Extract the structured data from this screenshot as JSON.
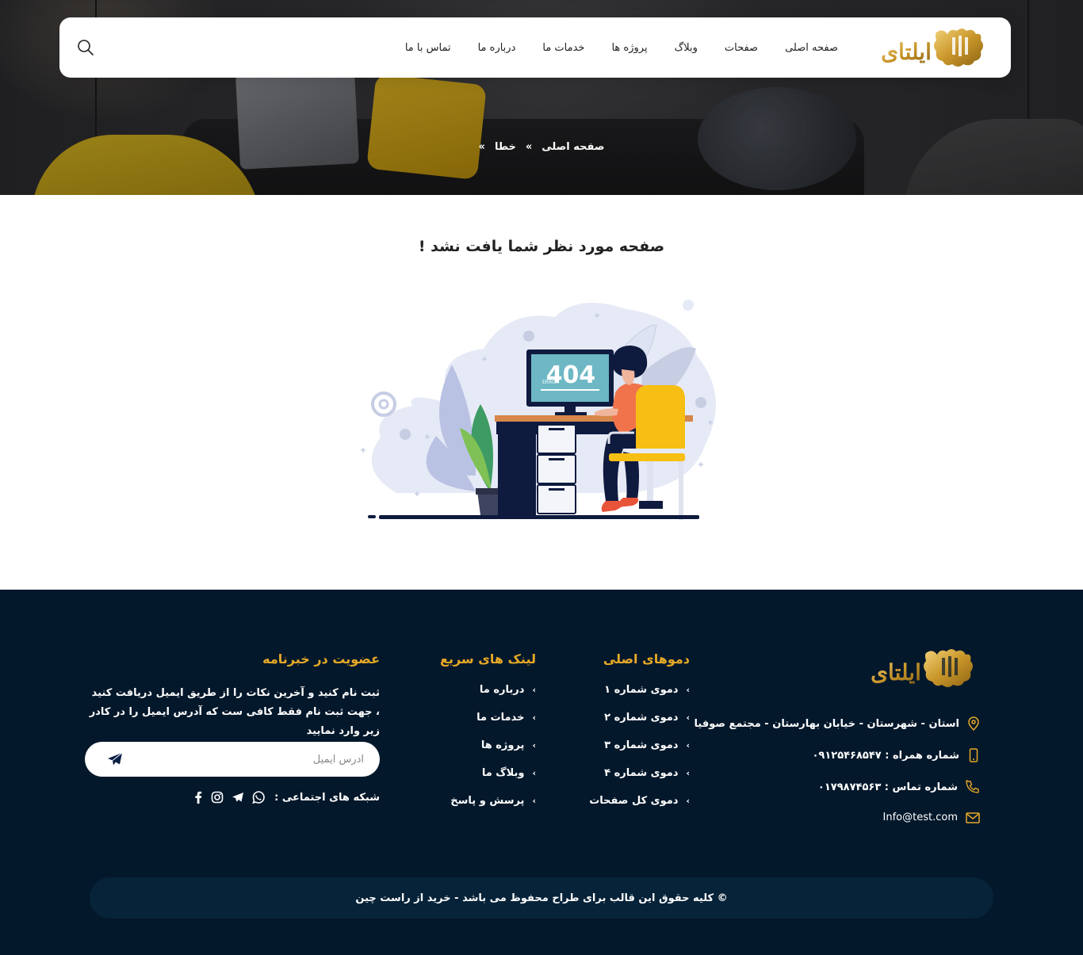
{
  "header": {
    "nav": [
      "صفحه اصلی",
      "صفحات",
      "وبلاگ",
      "پروژه ها",
      "خدمات ما",
      "درباره ما",
      "تماس با ما"
    ],
    "logo_text": "ایلتای"
  },
  "hero": {
    "breadcrumb": {
      "home": "صفحه اصلی",
      "sep1": "»",
      "current": "خطا",
      "sep2": "»"
    }
  },
  "main": {
    "title": "صفحه مورد نظر شما یافت نشد !",
    "illustration": {
      "code": "404",
      "caption": "ERROR"
    }
  },
  "footer": {
    "logo_text": "ایلتای",
    "contact": {
      "address": "استان - شهرستان - خیابان بهارستان - مجتمع صوفیا",
      "mobile": "شماره همراه : ۰۹۱۲۵۴۶۸۵۴۷",
      "phone": "شماره تماس : ۰۱۷۹۸۷۴۵۶۳",
      "email": "Info@test.com"
    },
    "demos": {
      "title": "دموهای اصلی",
      "items": [
        "دموی شماره ۱",
        "دموی شماره ۲",
        "دموی شماره ۳",
        "دموی شماره ۴",
        "دموی کل صفحات"
      ]
    },
    "quick_links": {
      "title": "لینک های سریع",
      "items": [
        "درباره ما",
        "خدمات ما",
        "پروژه ها",
        "وبلاگ ما",
        "پرسش و پاسخ"
      ]
    },
    "newsletter": {
      "title": "عضویت در خبرنامه",
      "text": "ثبت نام کنید و آخرین نکات را از طریق ایمیل دریافت کنید ، جهت ثبت نام فقط کافی ست که آدرس ایمیل را در کادر زیر وارد نمایید",
      "email_placeholder": "آدرس ایمیل",
      "social_label": "شبکه های اجتماعی :"
    },
    "copyright": "© کلیه حقوق این قالب برای طراح محفوظ می باشد -  خرید از راست چین"
  },
  "colors": {
    "accent": "#e7a927",
    "footer_bg": "#04182b",
    "copyright_bg": "#072339"
  }
}
